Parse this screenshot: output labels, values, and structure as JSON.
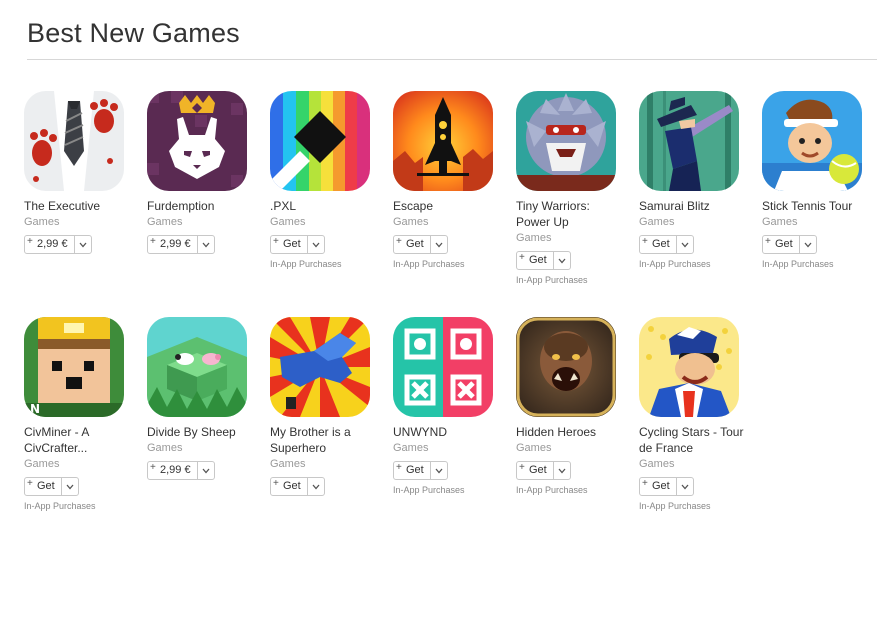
{
  "section": {
    "title": "Best New Games"
  },
  "rows": [
    [
      {
        "name": "The Executive",
        "category": "Games",
        "price": "2,99 €",
        "iap": ""
      },
      {
        "name": "Furdemption",
        "category": "Games",
        "price": "2,99 €",
        "iap": ""
      },
      {
        "name": ".PXL",
        "category": "Games",
        "price": "Get",
        "iap": "In-App Purchases"
      },
      {
        "name": "Escape",
        "category": "Games",
        "price": "Get",
        "iap": "In-App Purchases"
      },
      {
        "name": "Tiny Warriors: Power Up",
        "category": "Games",
        "price": "Get",
        "iap": "In-App Purchases"
      },
      {
        "name": "Samurai Blitz",
        "category": "Games",
        "price": "Get",
        "iap": "In-App Purchases"
      },
      {
        "name": "Stick Tennis Tour",
        "category": "Games",
        "price": "Get",
        "iap": "In-App Purchases"
      }
    ],
    [
      {
        "name": "CivMiner - A CivCrafter...",
        "category": "Games",
        "price": "Get",
        "iap": "In-App Purchases"
      },
      {
        "name": "Divide By Sheep",
        "category": "Games",
        "price": "2,99 €",
        "iap": ""
      },
      {
        "name": "My Brother is a Superhero",
        "category": "Games",
        "price": "Get",
        "iap": ""
      },
      {
        "name": "UNWYND",
        "category": "Games",
        "price": "Get",
        "iap": "In-App Purchases"
      },
      {
        "name": "Hidden Heroes",
        "category": "Games",
        "price": "Get",
        "iap": "In-App Purchases"
      },
      {
        "name": "Cycling Stars - Tour de France",
        "category": "Games",
        "price": "Get",
        "iap": "In-App Purchases"
      }
    ]
  ],
  "button": {
    "plus_symbol": "+"
  },
  "icons": {
    "r0c0": "executive-icon",
    "r0c1": "furdemption-icon",
    "r0c2": "pxl-icon",
    "r0c3": "escape-rocket-icon",
    "r0c4": "tiny-warriors-icon",
    "r0c5": "samurai-blitz-icon",
    "r0c6": "stick-tennis-icon",
    "r1c0": "civminer-icon",
    "r1c1": "divide-by-sheep-icon",
    "r1c2": "my-brother-superhero-icon",
    "r1c3": "unwynd-icon",
    "r1c4": "hidden-heroes-icon",
    "r1c5": "cycling-stars-icon"
  },
  "colors": {
    "title": "#333333",
    "category": "#999999",
    "divider": "#d7d7d7"
  }
}
